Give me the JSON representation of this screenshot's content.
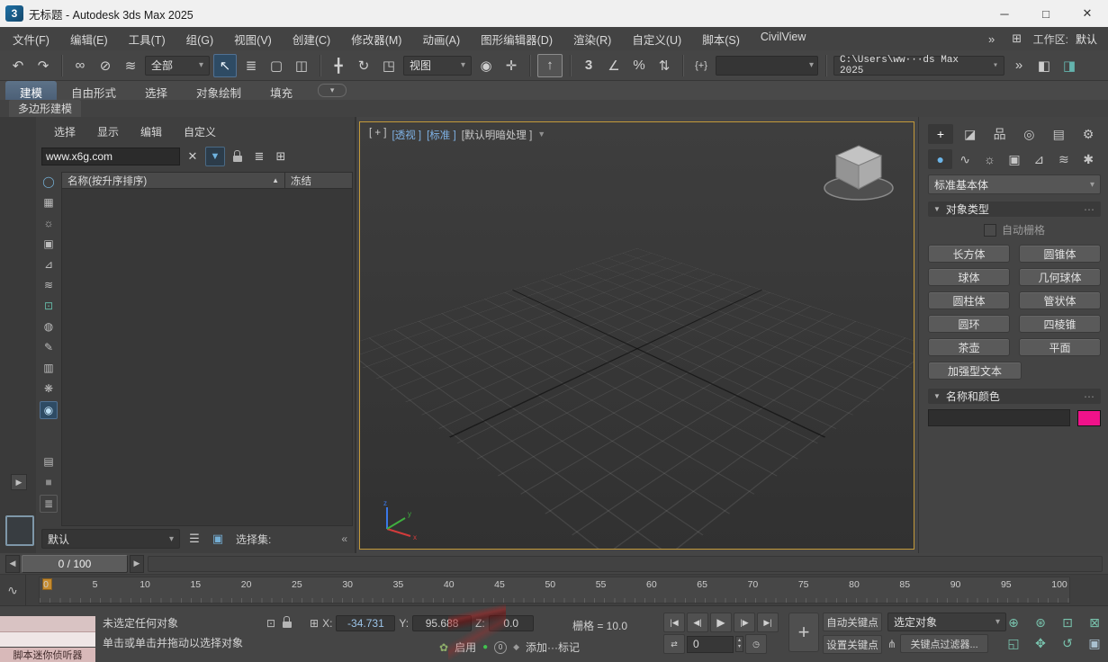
{
  "titlebar": {
    "title": "无标题 - Autodesk 3ds Max 2025"
  },
  "menubar": {
    "items": [
      "文件(F)",
      "编辑(E)",
      "工具(T)",
      "组(G)",
      "视图(V)",
      "创建(C)",
      "修改器(M)",
      "动画(A)",
      "图形编辑器(D)",
      "渲染(R)",
      "自定义(U)",
      "脚本(S)",
      "CivilView"
    ],
    "workspace_label": "工作区:",
    "workspace_value": "默认"
  },
  "toolbar": {
    "filter": "全部",
    "view": "视图",
    "path": "C:\\Users\\ww···ds Max 2025"
  },
  "ribbon": {
    "tabs": [
      "建模",
      "自由形式",
      "选择",
      "对象绘制",
      "填充"
    ],
    "active": "建模",
    "subtab": "多边形建模"
  },
  "explorer": {
    "menu": [
      "选择",
      "显示",
      "编辑",
      "自定义"
    ],
    "search": "www.x6g.com",
    "sort_column": "名称(按升序排序)",
    "freeze_column": "冻结",
    "preset": "默认",
    "selection_set_label": "选择集:"
  },
  "viewport": {
    "plus": "[ + ]",
    "pov": "[透视 ]",
    "preset": "[标准 ]",
    "shading": "[默认明暗处理 ]"
  },
  "panel": {
    "category": "标准基本体",
    "rollout_object_type": "对象类型",
    "autogrid": "自动栅格",
    "buttons": [
      "长方体",
      "圆锥体",
      "球体",
      "几何球体",
      "圆柱体",
      "管状体",
      "圆环",
      "四棱锥",
      "茶壶",
      "平面"
    ],
    "wide_button": "加强型文本",
    "rollout_name_color": "名称和颜色"
  },
  "timeslider": {
    "value": "0 / 100"
  },
  "trackbar": {
    "ticks": [
      "0",
      "5",
      "10",
      "15",
      "20",
      "25",
      "30",
      "35",
      "40",
      "45",
      "50",
      "55",
      "60",
      "65",
      "70",
      "75",
      "80",
      "85",
      "90",
      "95",
      "100"
    ]
  },
  "statusbar": {
    "listener_label": "脚本迷你侦听器",
    "prompt1": "未选定任何对象",
    "prompt2": "单击或单击并拖动以选择对象",
    "x_label": "X:",
    "x": "-34.731",
    "y_label": "Y:",
    "y": "95.688",
    "z_label": "Z:",
    "z": "0.0",
    "grid": "栅格 = 10.0",
    "enable": "启用",
    "zero_badge": "0",
    "add_marker": "添加···标记",
    "frame": "0",
    "auto_key": "自动关键点",
    "set_key": "设置关键点",
    "selected": "选定对象",
    "key_filters": "关键点过滤器..."
  },
  "colors": {
    "accent_blue": "#5a8fc0",
    "viewport_border": "#c49a3a",
    "object_color_swatch": "#f0128a",
    "frame_marker": "#c58b2f"
  },
  "icons": {
    "app": "3",
    "min": "─",
    "max": "□",
    "close": "✕",
    "more": "»",
    "workspace": "⊞",
    "dd": "▾",
    "undo": "↶",
    "redo": "↷",
    "link": "∞",
    "unlink": "⊘",
    "bind": "≋",
    "select": "↖",
    "byname": "≣",
    "region": "▢",
    "crossing": "◫",
    "move": "╋",
    "rotate": "↻",
    "scale": "◳",
    "center": "◉",
    "manip": "✛",
    "kbd": "↑",
    "snap3": "3",
    "snapang": "∠",
    "snappct": "%",
    "snapspin": "⇅",
    "namedsets": "{+}",
    "layerex": "◧",
    "render": "◨",
    "clear": "✕",
    "funnel": "▼",
    "treea": "≣",
    "treeb": "⊞",
    "f_obj": "◯",
    "f_layers": "▦",
    "f_lights": "☼",
    "f_cams": "▣",
    "f_help": "⊿",
    "f_warps": "≋",
    "f_cont": "⊡",
    "f_xref": "◍",
    "f_bones": "✎",
    "f_groups": "▥",
    "f_mats": "❋",
    "f_vis": "◉",
    "f_doc": "▤",
    "f_block": "■",
    "f_list": "≣",
    "collapse": "«",
    "layers": "☰",
    "selset": "▣",
    "expand": "▶",
    "cp1_create": "+",
    "cp1_modify": "◪",
    "cp1_hier": "品",
    "cp1_motion": "◎",
    "cp1_disp": "▤",
    "cp1_util": "⚙",
    "cp2_geo": "●",
    "cp2_shapes": "∿",
    "cp2_lights": "☼",
    "cp2_cams": "▣",
    "cp2_help": "⊿",
    "cp2_warps": "≋",
    "cp2_sys": "✱",
    "roll": "▼",
    "grip": "⋯",
    "tsprev": "◀",
    "tsnext": "▶",
    "curve": "∿",
    "iso": "⊡",
    "coordgrid": "⊞",
    "gostart": "|◀",
    "prevf": "◀|",
    "play": "▶",
    "nextf": "|▶",
    "goend": "▶|",
    "keymode": "⇄",
    "spinup": "▴",
    "spindn": "▾",
    "timecfg": "◷",
    "bigkey": "+",
    "keyfilter": "⋔",
    "plant": "✿",
    "dot": "●",
    "marker": "◆",
    "zoom": "⊕",
    "zoomall": "⊛",
    "zext": "⊡",
    "zextall": "⊠",
    "zregion": "◱",
    "pan": "✥",
    "orbit": "↺",
    "maxvp": "▣",
    "sort": "▲",
    "vpfunnel": "▼"
  }
}
